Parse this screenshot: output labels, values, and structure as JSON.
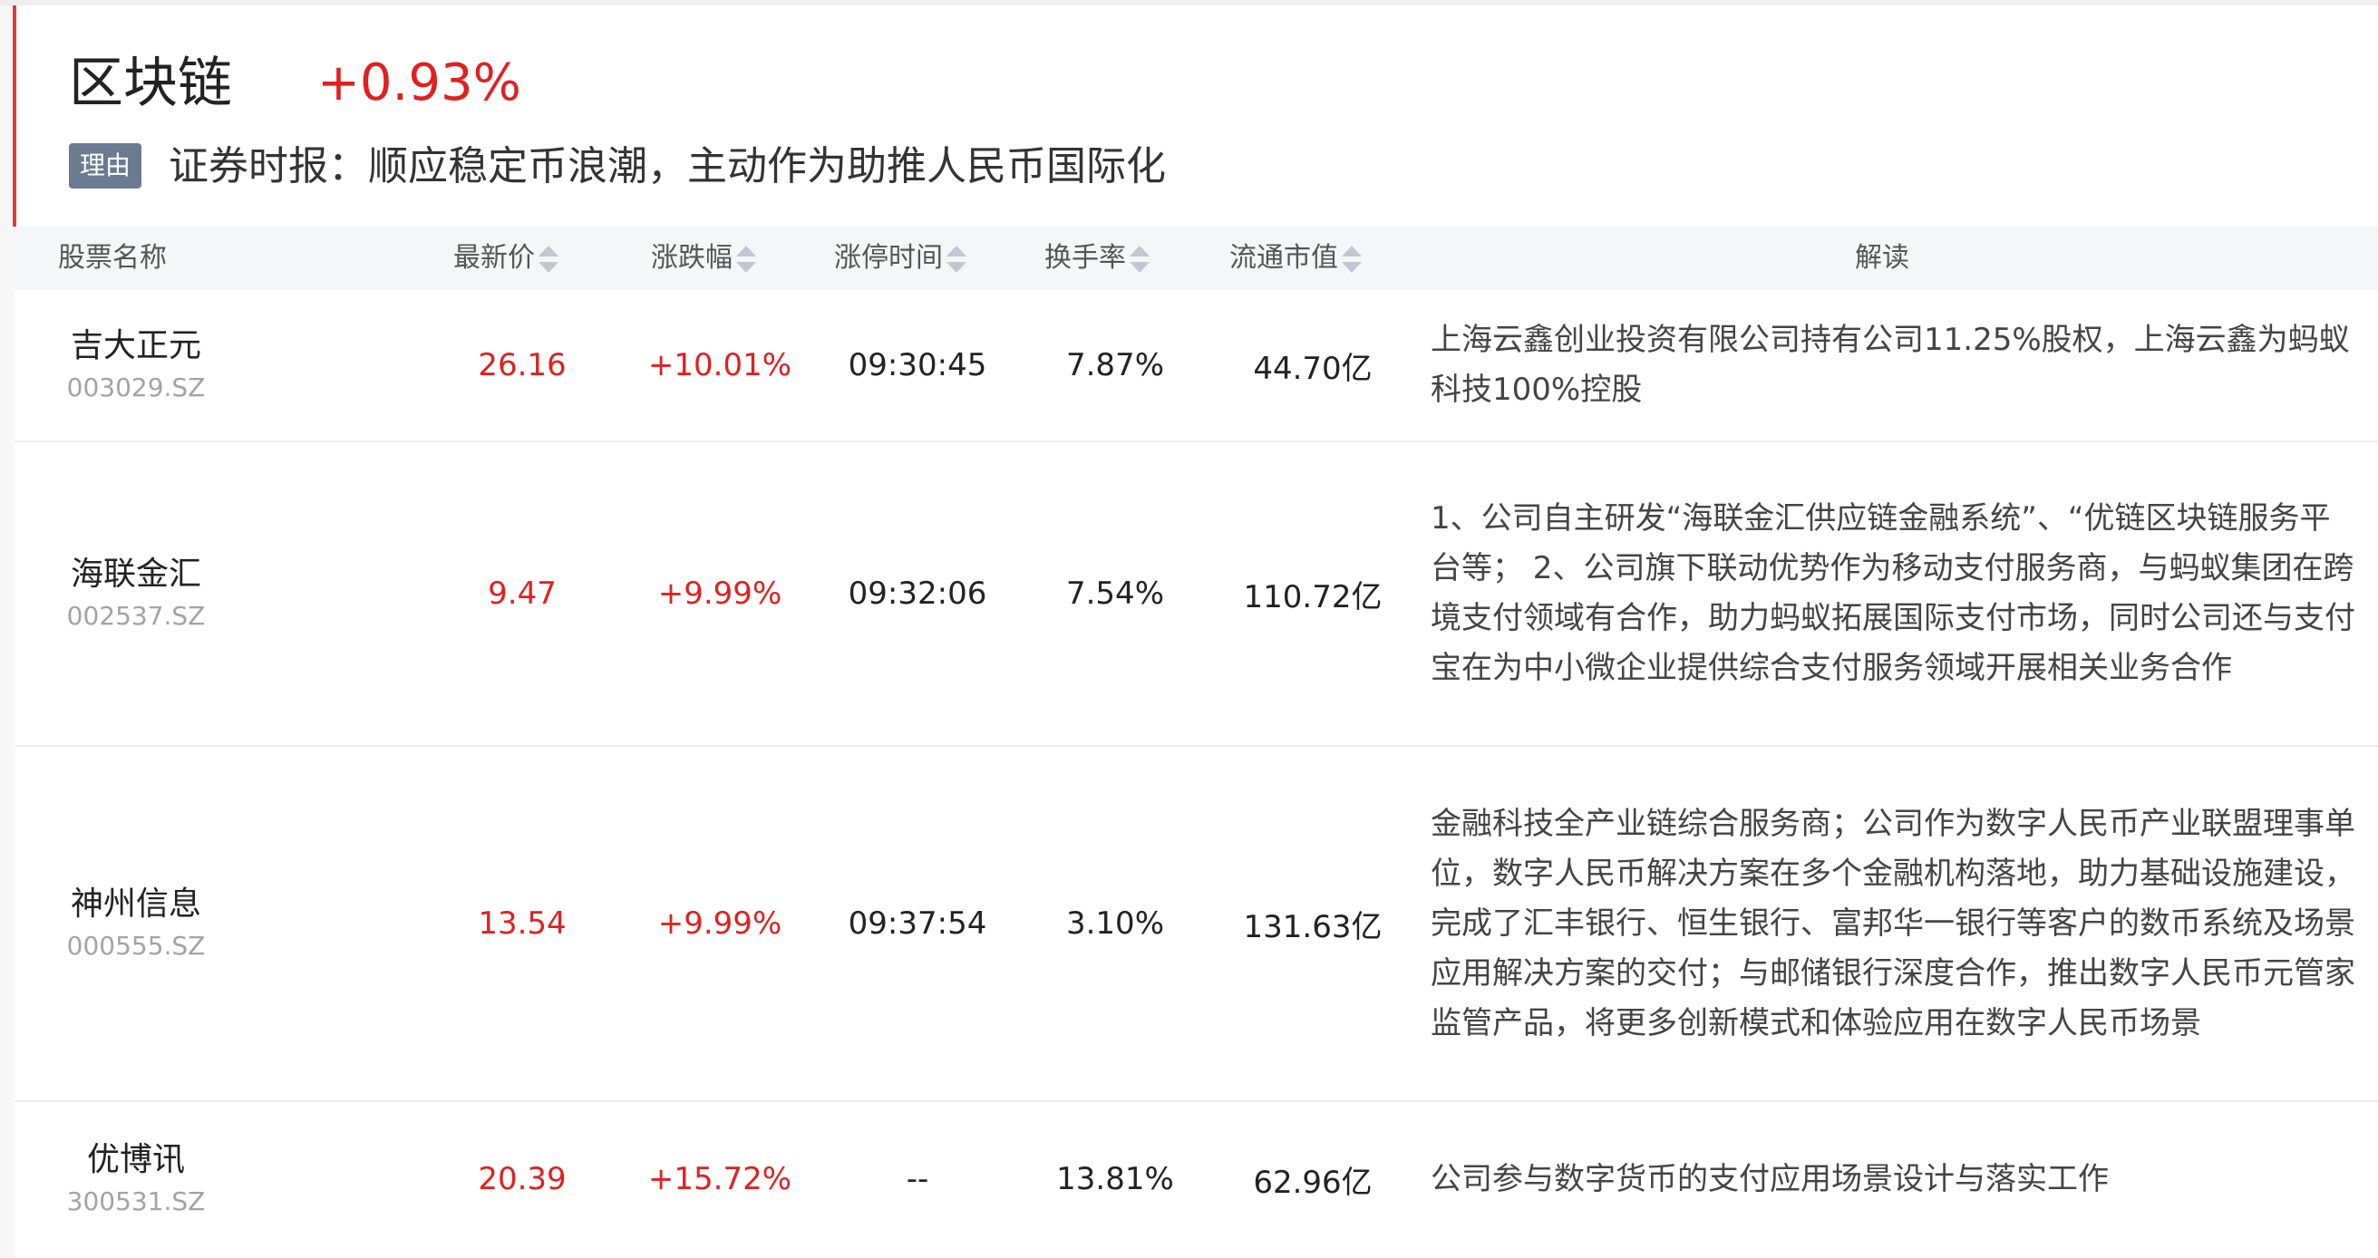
{
  "sector": {
    "name": "区块链",
    "change": "+0.93%",
    "reason_tag": "理由",
    "reason": "证券时报：顺应稳定币浪潮，主动作为助推人民币国际化"
  },
  "columns": {
    "name": "股票名称",
    "price": "最新价",
    "pct": "涨跌幅",
    "limit_time": "涨停时间",
    "turnover": "换手率",
    "mcap": "流通市值",
    "interp": "解读"
  },
  "rows": [
    {
      "name": "吉大正元",
      "code": "003029.SZ",
      "price": "26.16",
      "pct": "+10.01%",
      "limit_time": "09:30:45",
      "turnover": "7.87%",
      "mcap": "44.70亿",
      "interp": "上海云鑫创业投资有限公司持有公司11.25%股权，上海云鑫为蚂蚁科技100%控股"
    },
    {
      "name": "海联金汇",
      "code": "002537.SZ",
      "price": "9.47",
      "pct": "+9.99%",
      "limit_time": "09:32:06",
      "turnover": "7.54%",
      "mcap": "110.72亿",
      "interp": "1、公司自主研发“海联金汇供应链金融系统”、“优链区块链服务平台等； 2、公司旗下联动优势作为移动支付服务商，与蚂蚁集团在跨境支付领域有合作，助力蚂蚁拓展国际支付市场，同时公司还与支付宝在为中小微企业提供综合支付服务领域开展相关业务合作"
    },
    {
      "name": "神州信息",
      "code": "000555.SZ",
      "price": "13.54",
      "pct": "+9.99%",
      "limit_time": "09:37:54",
      "turnover": "3.10%",
      "mcap": "131.63亿",
      "interp": "金融科技全产业链综合服务商；公司作为数字人民币产业联盟理事单位，数字人民币解决方案在多个金融机构落地，助力基础设施建设，完成了汇丰银行、恒生银行、富邦华一银行等客户的数币系统及场景应用解决方案的交付；与邮储银行深度合作，推出数字人民币元管家监管产品，将更多创新模式和体验应用在数字人民币场景"
    },
    {
      "name": "优博讯",
      "code": "300531.SZ",
      "price": "20.39",
      "pct": "+15.72%",
      "limit_time": "--",
      "turnover": "13.81%",
      "mcap": "62.96亿",
      "interp": "公司参与数字货币的支付应用场景设计与落实工作"
    }
  ],
  "colors": {
    "up": "#e02020",
    "accent": "#e43a3a",
    "tag_bg": "#6b7a91"
  }
}
